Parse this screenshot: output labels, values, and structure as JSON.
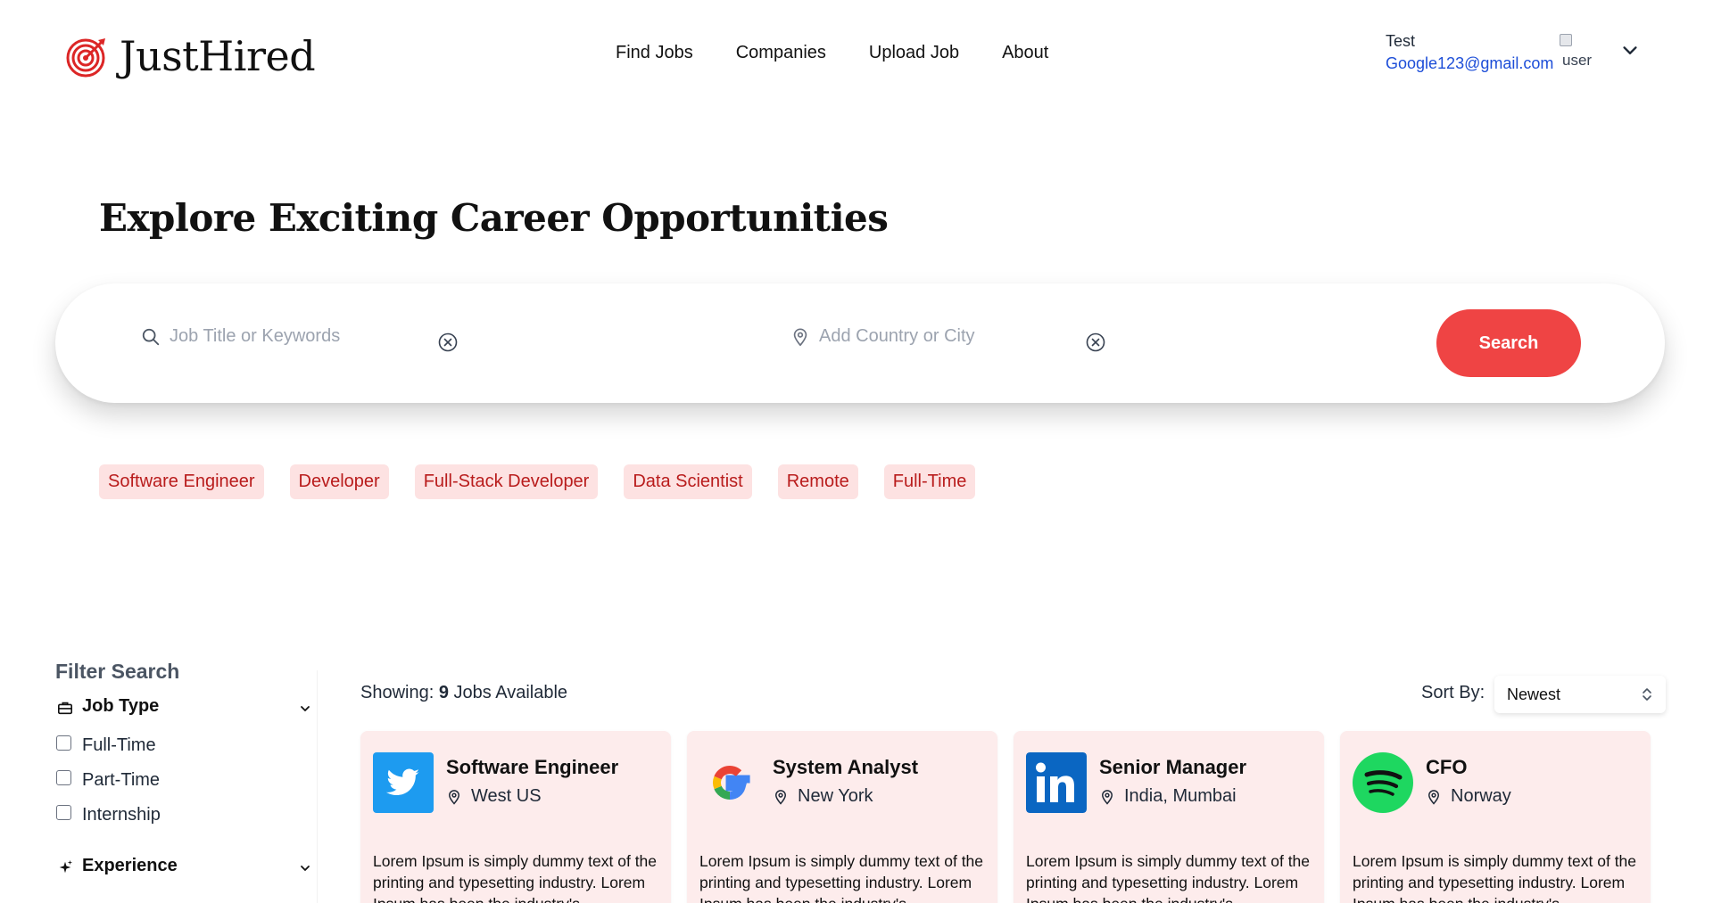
{
  "brand": {
    "name": "JustHired",
    "color": "#dc2626"
  },
  "nav": {
    "items": [
      "Find Jobs",
      "Companies",
      "Upload Job",
      "About"
    ]
  },
  "user": {
    "name": "Test",
    "email": "Google123@gmail.com",
    "avatar_alt": "user",
    "menu_icon": "chevron-down-icon"
  },
  "hero": {
    "title": "Explore Exciting Career Opportunities"
  },
  "search": {
    "job_placeholder": "Job Title or Keywords",
    "location_placeholder": "Add Country or City",
    "button_label": "Search",
    "button_color": "#ef4444"
  },
  "tags": [
    "Software Engineer",
    "Developer",
    "Full-Stack Developer",
    "Data Scientist",
    "Remote",
    "Full-Time"
  ],
  "filter": {
    "title": "Filter Search",
    "job_type": {
      "label": "Job Type",
      "icon": "briefcase-icon",
      "options": [
        "Full-Time",
        "Part-Time",
        "Internship"
      ]
    },
    "experience": {
      "label": "Experience",
      "icon": "sparkle-icon"
    }
  },
  "results": {
    "showing_prefix": "Showing:",
    "count": "9",
    "showing_suffix": "Jobs Available",
    "sort_label": "Sort By:",
    "sort_value": "Newest"
  },
  "jobs": [
    {
      "title": "Software Engineer",
      "location": "West US",
      "company_icon": "twitter-logo",
      "description": "Lorem Ipsum is simply dummy text of the printing and typesetting industry. Lorem Ipsum has been the industry's"
    },
    {
      "title": "System Analyst",
      "location": "New York",
      "company_icon": "google-logo",
      "description": "Lorem Ipsum is simply dummy text of the printing and typesetting industry. Lorem Ipsum has been the industry's"
    },
    {
      "title": "Senior Manager",
      "location": "India, Mumbai",
      "company_icon": "linkedin-logo",
      "description": "Lorem Ipsum is simply dummy text of the printing and typesetting industry. Lorem Ipsum has been the industry's"
    },
    {
      "title": "CFO",
      "location": "Norway",
      "company_icon": "spotify-logo",
      "description": "Lorem Ipsum is simply dummy text of the printing and typesetting industry. Lorem Ipsum has been the industry's"
    }
  ]
}
